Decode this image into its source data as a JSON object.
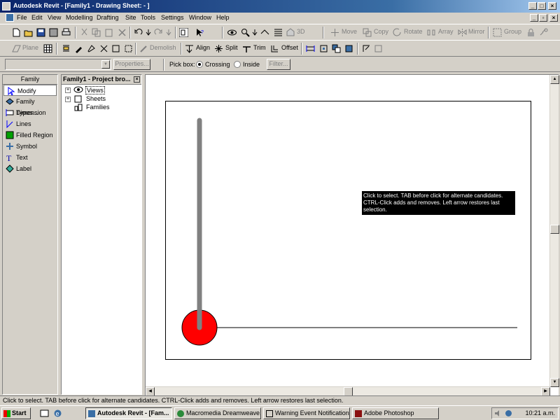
{
  "window": {
    "title": "Autodesk Revit - [Family1 - Drawing Sheet: - ]"
  },
  "menu": [
    "File",
    "Edit",
    "View",
    "Modelling",
    "Drafting",
    "Site",
    "Tools",
    "Settings",
    "Window",
    "Help"
  ],
  "toolbar1": {
    "label_3d": "3D",
    "move": "Move",
    "copy": "Copy",
    "rotate": "Rotate",
    "array": "Array",
    "mirror": "Mirror",
    "group": "Group"
  },
  "toolbar2": {
    "plane": "Plane",
    "demolish": "Demolish",
    "align": "Align",
    "split": "Split",
    "trim": "Trim",
    "offset": "Offset"
  },
  "options": {
    "properties": "Properties...",
    "pick_box": "Pick box:",
    "crossing": "Crossing",
    "inside": "Inside",
    "filter": "Filter..."
  },
  "family_panel": {
    "header": "Family",
    "items": [
      "Modify",
      "Family Types...",
      "Dimension",
      "Lines",
      "Filled Region",
      "Symbol",
      "Text",
      "Label"
    ]
  },
  "project_browser": {
    "header": "Family1 - Project bro...",
    "items": [
      "Views",
      "Sheets",
      "Families"
    ]
  },
  "canvas": {
    "tooltip": "Click to select. TAB before click for alternate candidates. CTRL-Click adds and removes. Left arrow restores last selection.",
    "circle_color": "#ff0000",
    "line_color": "#808080"
  },
  "statusbar": {
    "text": "Click to select. TAB before click for alternate candidates. CTRL-Click adds and removes. Left arrow restores last selection."
  },
  "taskbar": {
    "start": "Start",
    "tasks": [
      "Autodesk Revit - [Fam...",
      "Macromedia Dreamweave...",
      "Warning Event Notification",
      "Adobe Photoshop"
    ],
    "clock": "10:21 a.m."
  }
}
